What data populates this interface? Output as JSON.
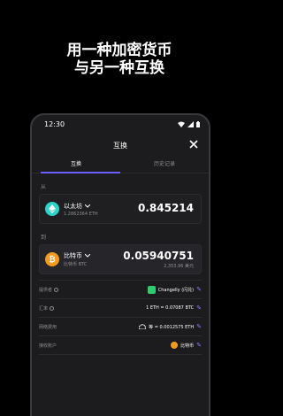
{
  "headline": [
    "用一种加密货币",
    "与另一种互换"
  ],
  "status": {
    "time": "12:30"
  },
  "title": "互换",
  "tabs": [
    "互换",
    "历史记录"
  ],
  "from": {
    "label": "从",
    "coin": "以太坊",
    "balance": "1.2862364 ETH",
    "amount": "0.845214"
  },
  "to": {
    "label": "到",
    "coin": "比特币",
    "sub": "比特币 BTC",
    "amount": "0.05940751",
    "fiat": "2,353.96 美元"
  },
  "details": [
    {
      "key": "提供者",
      "value": "Changelly (闪兑)",
      "icon": "changelly-icon"
    },
    {
      "key": "汇率",
      "value": "1 ETH = 0.07087 BTC",
      "icon": ""
    },
    {
      "key": "网络费用",
      "value": "等 = 0.0012575 ETH",
      "icon": "cloud-icon"
    },
    {
      "key": "接收账户",
      "value": "比特币",
      "icon": "bitcoin-icon"
    }
  ],
  "colors": {
    "accent": "#6b5cff",
    "eth": "#2bd3c9",
    "btc": "#f39a1f",
    "background": "#000000",
    "panel": "#1c1c1e"
  }
}
